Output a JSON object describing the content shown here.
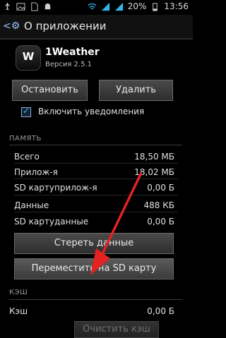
{
  "status_bar": {
    "battery_percent": "20%",
    "time": "13:56"
  },
  "header": {
    "title": "О приложении"
  },
  "app": {
    "name": "1Weather",
    "version": "Версия 2.5.1",
    "icon_letter": "W"
  },
  "actions": {
    "stop_label": "Остановить",
    "remove_label": "Удалить"
  },
  "notifications": {
    "label": "Включить уведомления",
    "checked": true
  },
  "memory": {
    "title": "ПАМЯТЬ",
    "rows": [
      {
        "label": "Всего",
        "value": "18,50 МБ"
      },
      {
        "label": "Прилож-я",
        "value": "18,02 МБ"
      },
      {
        "label": "SD картуприлож-я",
        "value": "0,00 Б"
      },
      {
        "label": "Данные",
        "value": "488 КБ"
      },
      {
        "label": "SD картуданные",
        "value": "0,00 Б"
      }
    ],
    "clear_data_label": "Стереть данные",
    "move_to_sd_label": "Переместить на SD карту"
  },
  "cache": {
    "title": "КЭШ",
    "row_label": "Кэш",
    "row_value": "0,00 Б",
    "clear_label": "Очистить кэш"
  },
  "colors": {
    "accent": "#33b5e5",
    "arrow": "#e32222"
  }
}
